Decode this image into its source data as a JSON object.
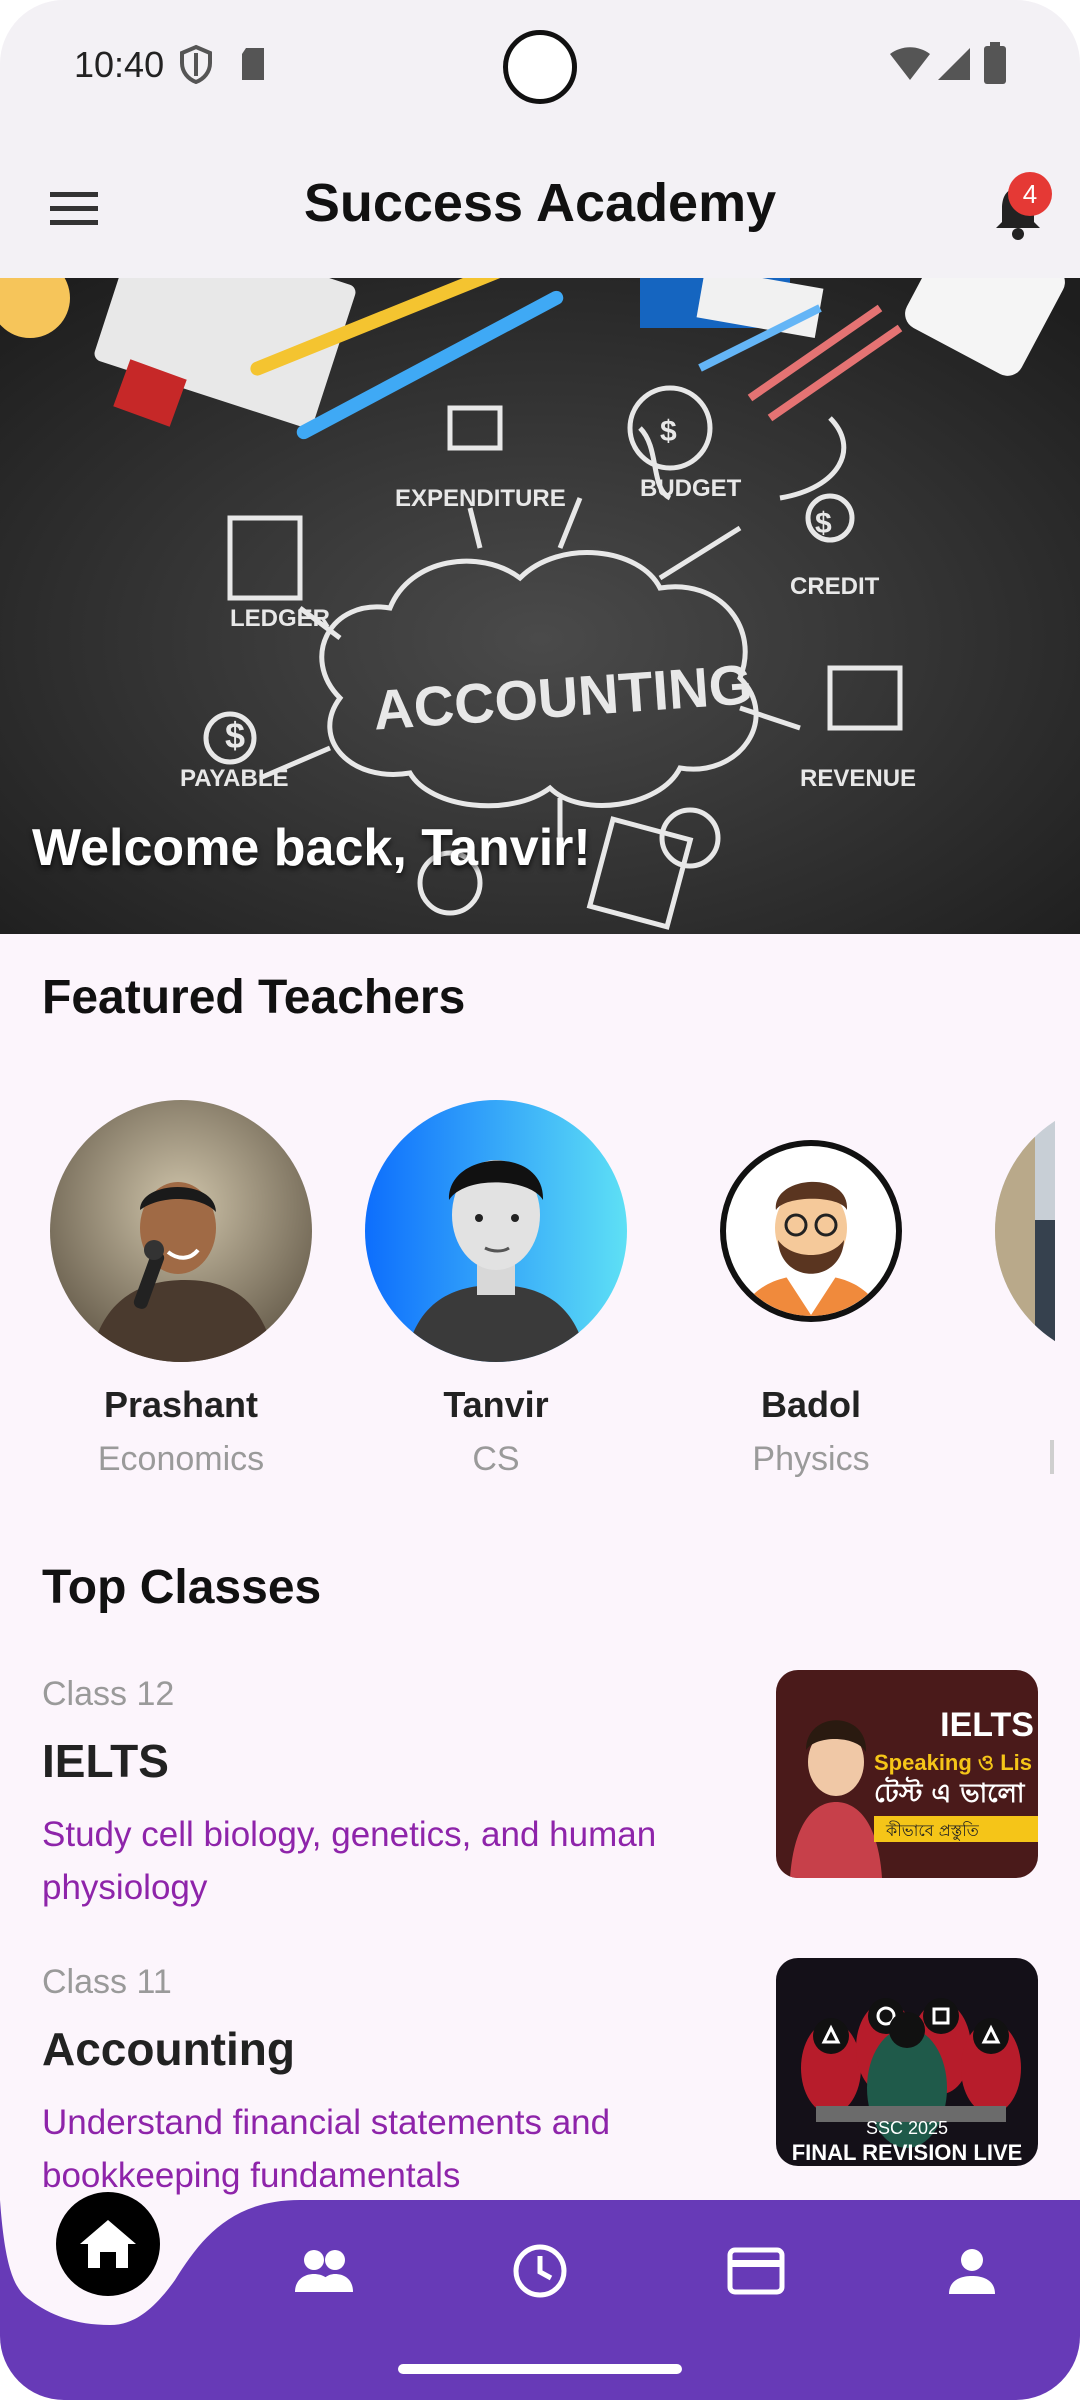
{
  "status_bar": {
    "time": "10:40"
  },
  "app_bar": {
    "title": "Success Academy",
    "notification_count": "4"
  },
  "hero": {
    "greeting": "Welcome back, Tanvir!"
  },
  "featured_teachers": {
    "title": "Featured Teachers",
    "items": [
      {
        "name": "Prashant",
        "subject": "Economics"
      },
      {
        "name": "Tanvir",
        "subject": "CS"
      },
      {
        "name": "Badol",
        "subject": "Physics"
      }
    ]
  },
  "top_classes": {
    "title": "Top Classes",
    "items": [
      {
        "level": "Class 12",
        "title": "IELTS",
        "description": "Study cell biology, genetics, and human physiology"
      },
      {
        "level": "Class 11",
        "title": "Accounting",
        "description": "Understand financial statements and bookkeeping fundamentals"
      }
    ]
  },
  "colors": {
    "nav_purple": "#673ab7",
    "accent_purple": "#8e24aa",
    "badge_red": "#e53935"
  },
  "bottom_nav": {
    "items": [
      "home-icon",
      "people-icon",
      "clock-icon",
      "card-icon",
      "person-icon"
    ]
  }
}
